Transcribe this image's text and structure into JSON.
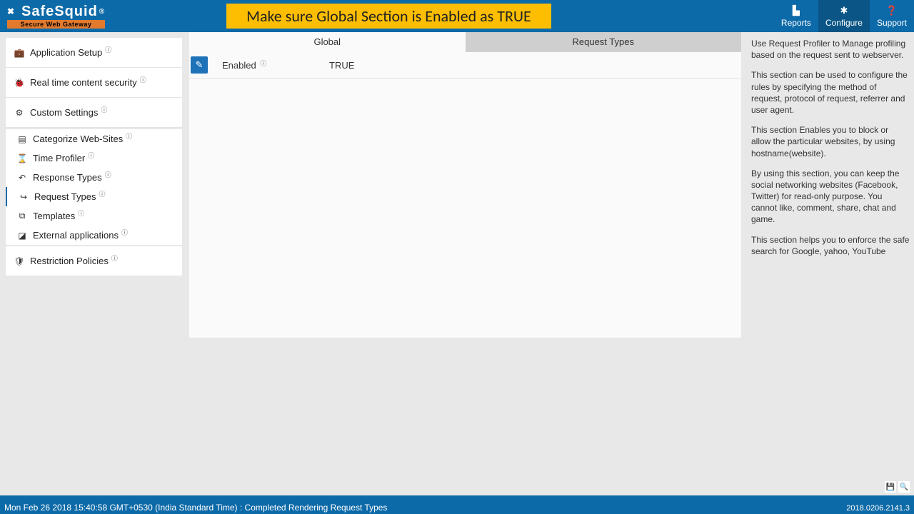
{
  "header": {
    "logo_text": "SafeSquid",
    "logo_reg": "®",
    "logo_sub": "Secure Web Gateway",
    "banner": "Make sure Global Section is Enabled as TRUE"
  },
  "topnav": {
    "reports": "Reports",
    "configure": "Configure",
    "support": "Support"
  },
  "sidebar": {
    "app_setup": "Application Setup",
    "rtcs": "Real time content security",
    "custom": "Custom Settings",
    "cat": "Categorize Web-Sites",
    "time": "Time Profiler",
    "resp": "Response Types",
    "req": "Request Types",
    "tmpl": "Templates",
    "ext": "External applications",
    "restrict": "Restriction Policies"
  },
  "tabs": {
    "global": "Global",
    "reqtypes": "Request Types"
  },
  "global": {
    "enabled_label": "Enabled",
    "enabled_value": "TRUE"
  },
  "help": {
    "p1": "Use Request Profiler to Manage profiling based on the request sent to webserver.",
    "p2": "This section can be used to configure the rules by specifying the method of request, protocol of request, referrer and user agent.",
    "p3": "This section Enables you to block or allow the particular websites, by using hostname(website).",
    "p4": "By using this section, you can keep the social networking websites (Facebook, Twitter) for read-only purpose. You cannot like, comment, share, chat and game.",
    "p5": "This section helps you to enforce the safe search for Google, yahoo, YouTube"
  },
  "footer": {
    "status": "Mon Feb 26 2018 15:40:58 GMT+0530 (India Standard Time) : Completed Rendering Request Types",
    "version": "2018.0206.2141.3"
  }
}
